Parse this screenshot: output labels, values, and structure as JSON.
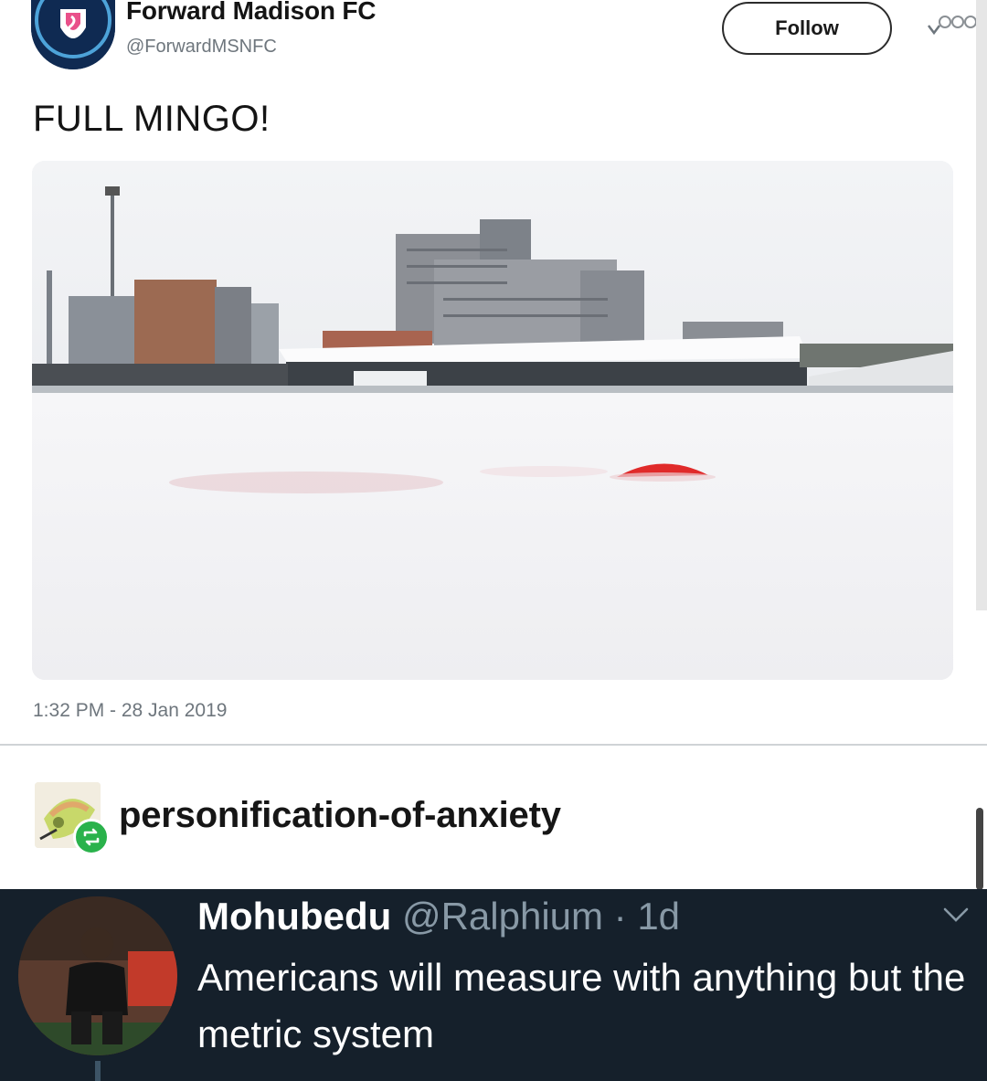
{
  "tweet": {
    "display_name": "Forward Madison FC",
    "handle": "@ForwardMSNFC",
    "follow_label": "Follow",
    "text": "FULL MINGO!",
    "timestamp": "1:32 PM - 28 Jan 2019",
    "photo_description_icon": "snow-covered-stadium-photo",
    "icons": {
      "more": "more-options-icon",
      "avatar": "club-crest-icon"
    }
  },
  "reblog": {
    "username": "personification-of-anxiety",
    "icons": {
      "avatar": "user-avatar-icon",
      "badge": "reblog-icon"
    },
    "colors": {
      "badge": "#2ab24b"
    }
  },
  "reply": {
    "name": "Mohubedu",
    "handle_time": "@Ralphium · 1d",
    "text": "Americans will measure with anything but the metric system",
    "icons": {
      "avatar": "user-avatar-icon",
      "menu": "chevron-down-icon"
    },
    "colors": {
      "background": "#15202b",
      "secondary_text": "#8899a6"
    }
  }
}
